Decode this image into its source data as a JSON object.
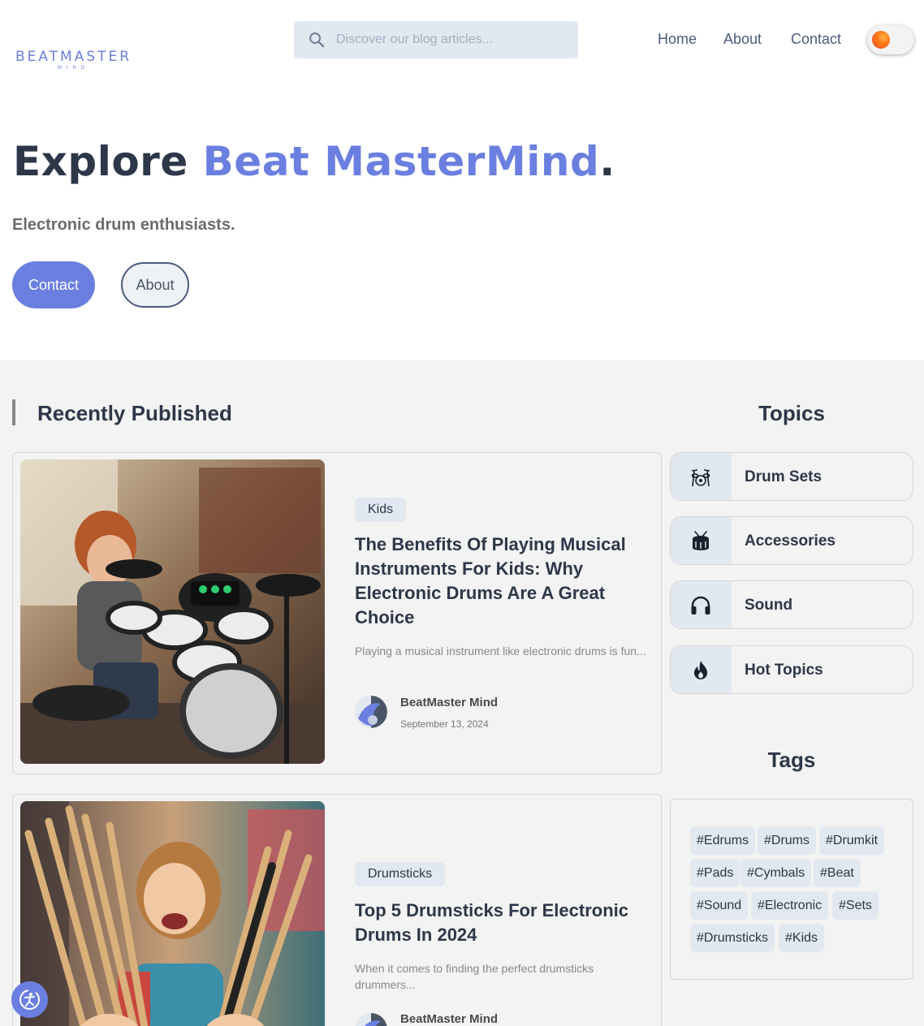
{
  "header": {
    "logo": {
      "text": "BEATMASTER",
      "subtext": "MIND"
    },
    "search": {
      "placeholder": "Discover our blog articles..."
    },
    "nav": {
      "home": "Home",
      "about": "About",
      "contact": "Contact"
    }
  },
  "hero": {
    "title_prefix": "Explore ",
    "title_accent": "Beat MasterMind",
    "title_suffix": ".",
    "subtitle": "Electronic drum enthusiasts.",
    "contact_button": "Contact",
    "about_button": "About"
  },
  "recent": {
    "heading": "Recently Published",
    "posts": [
      {
        "tag": "Kids",
        "title": "The Benefits Of Playing Musical Instruments For Kids: Why Electronic Drums Are A Great Choice",
        "excerpt": "Playing a musical instrument like electronic drums is fun...",
        "author": "BeatMaster Mind",
        "date": "September 13, 2024"
      },
      {
        "tag": "Drumsticks",
        "title": "Top 5 Drumsticks For Electronic Drums In 2024",
        "excerpt": "When it comes to finding the perfect drumsticks drummers...",
        "author": "BeatMaster Mind",
        "date": ""
      }
    ]
  },
  "topics": {
    "heading": "Topics",
    "items": [
      {
        "label": "Drum Sets",
        "icon": "drum-set-icon"
      },
      {
        "label": "Accessories",
        "icon": "drum-icon"
      },
      {
        "label": "Sound",
        "icon": "headphones-icon"
      },
      {
        "label": "Hot Topics",
        "icon": "fire-icon"
      }
    ]
  },
  "tags": {
    "heading": "Tags",
    "items": [
      "#Edrums",
      "#Drums",
      "#Drumkit",
      "#Pads",
      "#Cymbals",
      "#Beat",
      "#Sound",
      "#Electronic",
      "#Sets",
      "#Drumsticks",
      "#Kids"
    ]
  },
  "colors": {
    "accent": "#6b7fe0",
    "text_dark": "#2d3748",
    "tag_bg": "#e2e8f0",
    "section_bg": "#f3f3f3"
  }
}
